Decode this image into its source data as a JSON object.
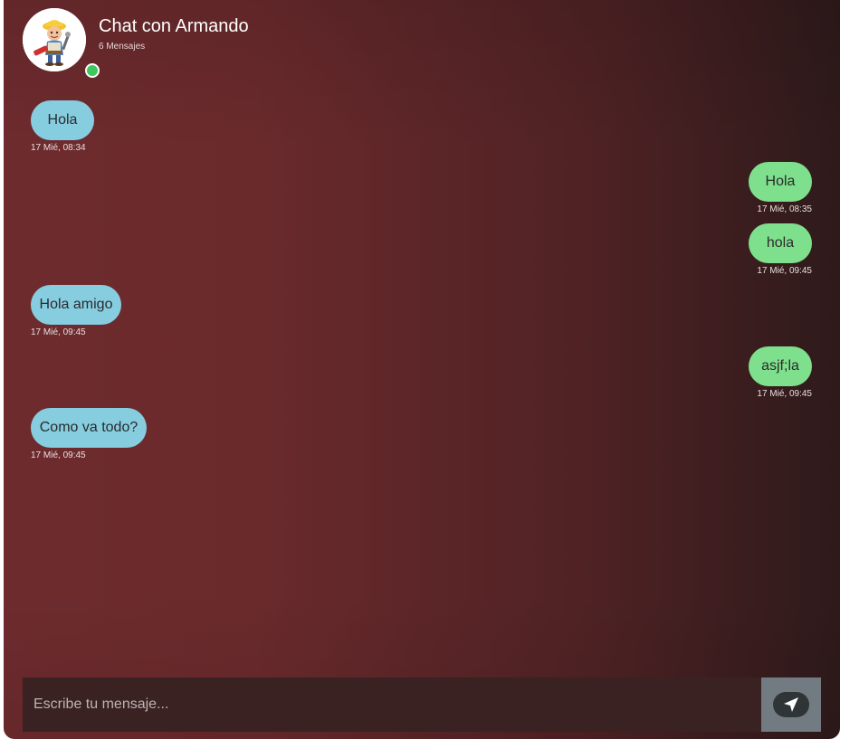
{
  "header": {
    "title": "Chat con Armando",
    "message_count": "6 Mensajes",
    "avatar_icon": "construction-worker-avatar",
    "status": "online"
  },
  "messages": [
    {
      "side": "received",
      "text": "Hola",
      "time": "17 Mié, 08:34"
    },
    {
      "side": "sent",
      "text": "Hola",
      "time": "17 Mié, 08:35"
    },
    {
      "side": "sent",
      "text": "hola",
      "time": "17 Mié, 09:45"
    },
    {
      "side": "received",
      "text": "Hola amigo",
      "time": "17 Mié, 09:45"
    },
    {
      "side": "sent",
      "text": "asjf;la",
      "time": "17 Mié, 09:45"
    },
    {
      "side": "received",
      "text": "Como va todo?",
      "time": "17 Mié, 09:45"
    }
  ],
  "composer": {
    "placeholder": "Escribe tu mensaje...",
    "value": "",
    "send_icon": "location-arrow-icon"
  },
  "colors": {
    "received_bubble": "#86cde0",
    "sent_bubble": "#7ee08c",
    "online_status": "#3cc85a",
    "send_button": "#737b82"
  }
}
